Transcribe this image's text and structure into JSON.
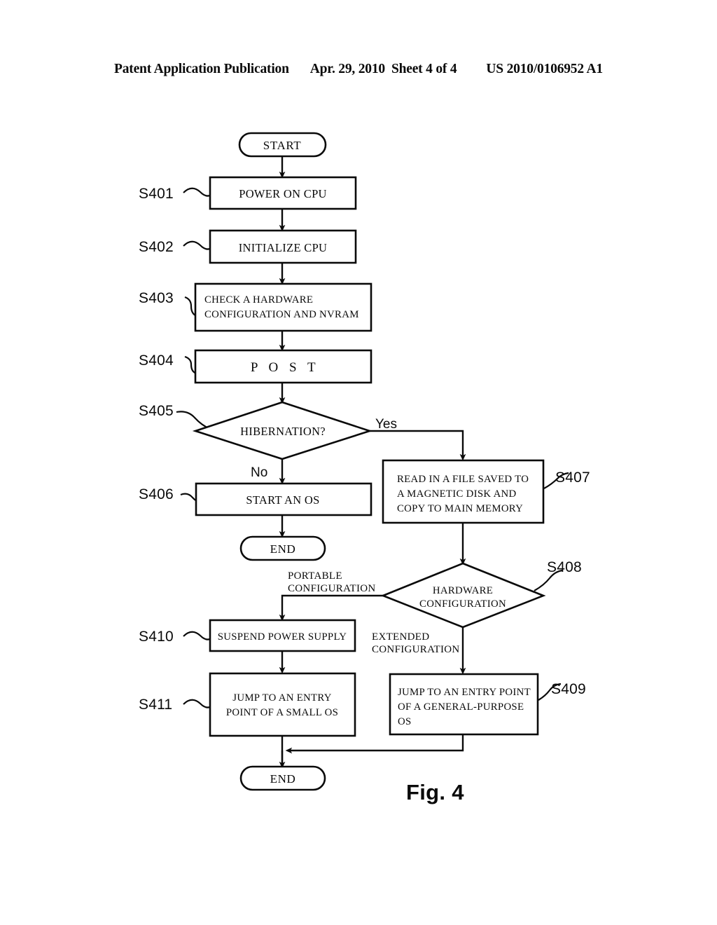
{
  "header": {
    "publication": "Patent Application Publication",
    "date": "Apr. 29, 2010",
    "sheet": "Sheet 4 of 4",
    "patent_number": "US 2010/0106952 A1"
  },
  "figure": {
    "caption": "Fig. 4",
    "type": "flowchart",
    "start_label": "START",
    "end_label_left": "END",
    "end_label_bottom": "END",
    "nodes": [
      {
        "id": "start",
        "step": "",
        "shape": "terminator",
        "text": "START"
      },
      {
        "id": "s401",
        "step": "S401",
        "shape": "process",
        "text": "POWER ON CPU"
      },
      {
        "id": "s402",
        "step": "S402",
        "shape": "process",
        "text": "INITIALIZE CPU"
      },
      {
        "id": "s403",
        "step": "S403",
        "shape": "process",
        "text_line1": "CHECK A HARDWARE",
        "text_line2": "CONFIGURATION AND NVRAM"
      },
      {
        "id": "s404",
        "step": "S404",
        "shape": "process",
        "text": "P O S T"
      },
      {
        "id": "s405",
        "step": "S405",
        "shape": "decision",
        "text": "HIBERNATION?"
      },
      {
        "id": "s406",
        "step": "S406",
        "shape": "process",
        "text": "START AN OS"
      },
      {
        "id": "end1",
        "step": "",
        "shape": "terminator",
        "text": "END"
      },
      {
        "id": "s407",
        "step": "S407",
        "shape": "process",
        "text_line1": "READ IN A FILE SAVED TO",
        "text_line2": "A MAGNETIC DISK AND",
        "text_line3": "COPY TO MAIN MEMORY"
      },
      {
        "id": "s408",
        "step": "S408",
        "shape": "decision",
        "text_line1": "HARDWARE",
        "text_line2": "CONFIGURATION"
      },
      {
        "id": "s409",
        "step": "S409",
        "shape": "process",
        "text_line1": "JUMP TO AN ENTRY POINT",
        "text_line2": "OF A GENERAL-PURPOSE",
        "text_line3": "OS"
      },
      {
        "id": "s410",
        "step": "S410",
        "shape": "process",
        "text": "SUSPEND POWER SUPPLY"
      },
      {
        "id": "s411",
        "step": "S411",
        "shape": "process",
        "text_line1": "JUMP TO AN ENTRY",
        "text_line2": "POINT OF A SMALL OS"
      },
      {
        "id": "end2",
        "step": "",
        "shape": "terminator",
        "text": "END"
      }
    ],
    "edge_labels": {
      "hibernation_yes": "Yes",
      "hibernation_no": "No",
      "hw_portable_line1": "PORTABLE",
      "hw_portable_line2": "CONFIGURATION",
      "hw_extended_line1": "EXTENDED",
      "hw_extended_line2": "CONFIGURATION"
    }
  }
}
